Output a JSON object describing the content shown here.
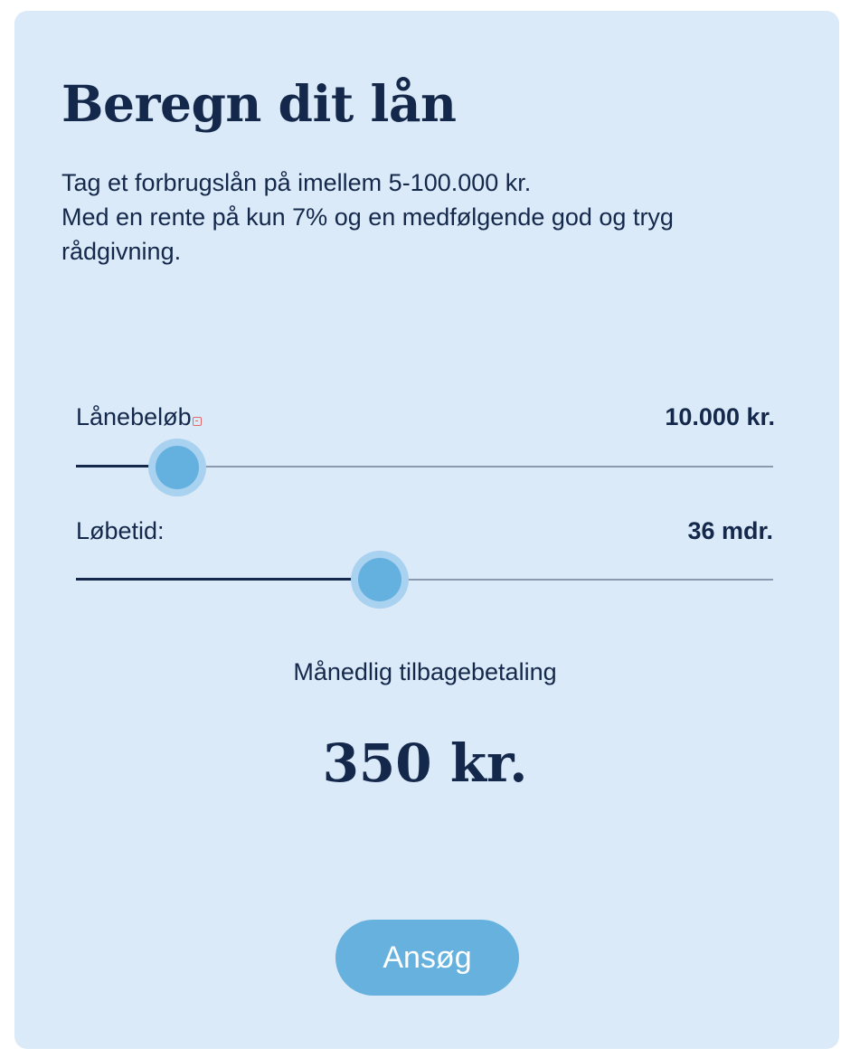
{
  "calculator": {
    "title": "Beregn dit lån",
    "description_line1": "Tag et forbrugslån på imellem 5-100.000 kr.",
    "description_line2": "Med en rente på kun 7% og en medfølgende god og tryg rådgivning."
  },
  "loan_amount": {
    "label": "Lånebeløb",
    "value_text": "10.000 kr.",
    "slider_fraction": 0.145
  },
  "term": {
    "label": "Løbetid:",
    "value_text": "36 mdr.",
    "slider_fraction": 0.435
  },
  "result": {
    "label": "Månedlig tilbagebetaling",
    "value": "350 kr."
  },
  "apply_button": {
    "label": "Ansøg"
  },
  "colors": {
    "card_background": "#dbeaf8",
    "text": "#14284b",
    "accent": "#66b1de"
  }
}
